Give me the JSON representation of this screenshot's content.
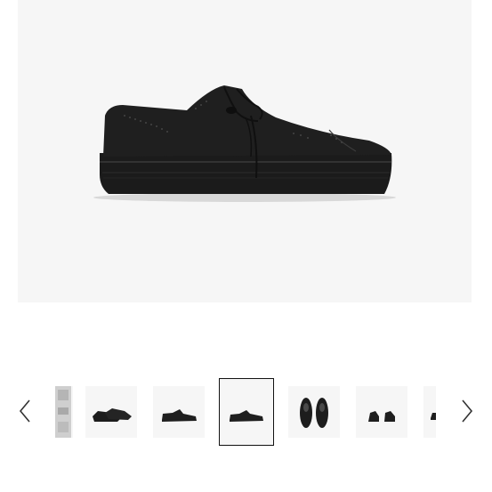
{
  "gallery": {
    "main_image": {
      "alt_icon": "black-brogue-platform-shoe-side-view"
    },
    "prev_arrow_icon": "chevron-left-icon",
    "next_arrow_icon": "chevron-right-icon",
    "selected_index": 3,
    "thumbnails": [
      {
        "icon": "packaging-thumbnail"
      },
      {
        "icon": "shoe-pair-angle-thumbnail"
      },
      {
        "icon": "shoe-side-thumbnail"
      },
      {
        "icon": "shoe-side-selected-thumbnail"
      },
      {
        "icon": "shoe-top-view-thumbnail"
      },
      {
        "icon": "shoe-pair-front-thumbnail"
      },
      {
        "icon": "shoe-partial-thumbnail"
      }
    ]
  }
}
